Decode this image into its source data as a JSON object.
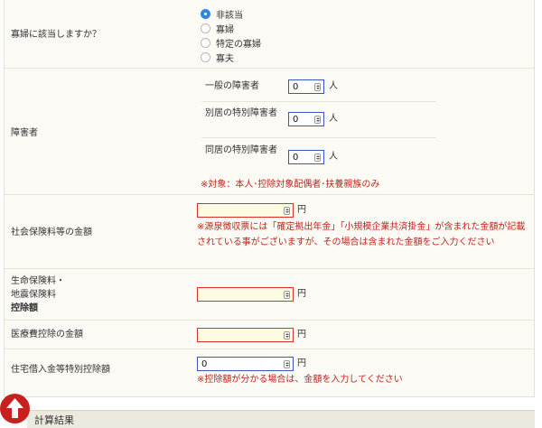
{
  "widow_question": {
    "label": "寡婦に該当しますか？",
    "options": [
      {
        "label": "非該当",
        "selected": true
      },
      {
        "label": "寡婦",
        "selected": false
      },
      {
        "label": "特定の寡婦",
        "selected": false
      },
      {
        "label": "寡夫",
        "selected": false
      }
    ]
  },
  "disabled": {
    "label": "障害者",
    "rows": [
      {
        "label": "一般の障害者",
        "value": "0",
        "unit": "人"
      },
      {
        "label": "別居の特別障害者",
        "value": "0",
        "unit": "人"
      },
      {
        "label": "同居の特別障害者",
        "value": "0",
        "unit": "人"
      }
    ],
    "note": "※対象：本人･控除対象配偶者･扶養親族のみ"
  },
  "social_insurance": {
    "label": "社会保険料等の金額",
    "value": "",
    "unit": "円",
    "note": "※源泉徴収票には「確定拠出年金」「小規模企業共済掛金」が含まれた金額が記載されている事がございますが、その場合は含まれた金額をご入力ください"
  },
  "life_insurance": {
    "label_line1": "生命保険料・",
    "label_line2": "地震保険料",
    "label_line3": "控除額",
    "value": "",
    "unit": "円"
  },
  "medical": {
    "label": "医療費控除の金額",
    "value": "",
    "unit": "円"
  },
  "housing_loan": {
    "label": "住宅借入金等特別控除額",
    "value": "0",
    "unit": "円",
    "note": "※控除額が分かる場合は、金額を入力してください"
  },
  "result_section": {
    "title": "計算結果"
  },
  "colors": {
    "accent_blue": "#2e86e6",
    "input_border_blue": "#3a55c8",
    "error_red": "#d9302c",
    "note_red": "#c0251f",
    "background": "#fbfaf5"
  },
  "icons": {
    "scroll_top": "arrow-up-circle-icon"
  }
}
